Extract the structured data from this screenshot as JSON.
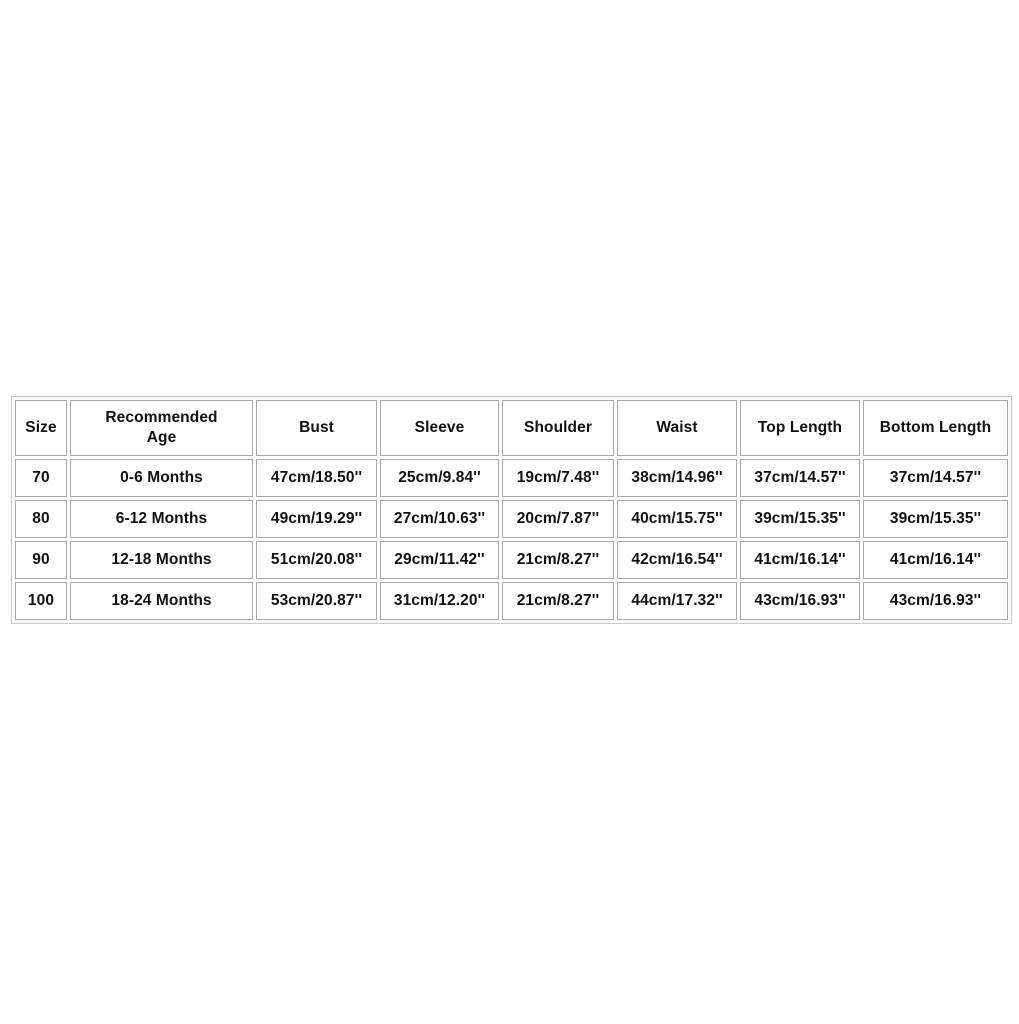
{
  "page": {
    "background_color": "#ffffff",
    "table_border_color": "#c9c9c9",
    "cell_border_color": "#a8a8a8",
    "text_color": "#111111"
  },
  "chart_data": {
    "type": "table",
    "title": "",
    "columns": [
      "Size",
      "Recommended Age",
      "Bust",
      "Sleeve",
      "Shoulder",
      "Waist",
      "Top Length",
      "Bottom Length"
    ],
    "rows": [
      [
        "70",
        "0-6 Months",
        "47cm/18.50''",
        "25cm/9.84''",
        "19cm/7.48''",
        "38cm/14.96''",
        "37cm/14.57''",
        "37cm/14.57''"
      ],
      [
        "80",
        "6-12 Months",
        "49cm/19.29''",
        "27cm/10.63''",
        "20cm/7.87''",
        "40cm/15.75''",
        "39cm/15.35''",
        "39cm/15.35''"
      ],
      [
        "90",
        "12-18 Months",
        "51cm/20.08''",
        "29cm/11.42''",
        "21cm/8.27''",
        "42cm/16.54''",
        "41cm/16.14''",
        "41cm/16.14''"
      ],
      [
        "100",
        "18-24 Months",
        "53cm/20.87''",
        "31cm/12.20''",
        "21cm/8.27''",
        "44cm/17.32''",
        "43cm/16.93''",
        "43cm/16.93''"
      ]
    ]
  },
  "table": {
    "headers": {
      "size": "Size",
      "age_line1": "Recommended",
      "age_line2": "Age",
      "bust": "Bust",
      "sleeve": "Sleeve",
      "shoulder": "Shoulder",
      "waist": "Waist",
      "top_length": "Top Length",
      "bottom_length": "Bottom Length"
    },
    "rows": [
      {
        "size": "70",
        "age": "0-6 Months",
        "bust": "47cm/18.50''",
        "sleeve": "25cm/9.84''",
        "shoulder": "19cm/7.48''",
        "waist": "38cm/14.96''",
        "top_length": "37cm/14.57''",
        "bottom_length": "37cm/14.57''"
      },
      {
        "size": "80",
        "age": "6-12 Months",
        "bust": "49cm/19.29''",
        "sleeve": "27cm/10.63''",
        "shoulder": "20cm/7.87''",
        "waist": "40cm/15.75''",
        "top_length": "39cm/15.35''",
        "bottom_length": "39cm/15.35''"
      },
      {
        "size": "90",
        "age": "12-18 Months",
        "bust": "51cm/20.08''",
        "sleeve": "29cm/11.42''",
        "shoulder": "21cm/8.27''",
        "waist": "42cm/16.54''",
        "top_length": "41cm/16.14''",
        "bottom_length": "41cm/16.14''"
      },
      {
        "size": "100",
        "age": "18-24 Months",
        "bust": "53cm/20.87''",
        "sleeve": "31cm/12.20''",
        "shoulder": "21cm/8.27''",
        "waist": "44cm/17.32''",
        "top_length": "43cm/16.93''",
        "bottom_length": "43cm/16.93''"
      }
    ]
  }
}
